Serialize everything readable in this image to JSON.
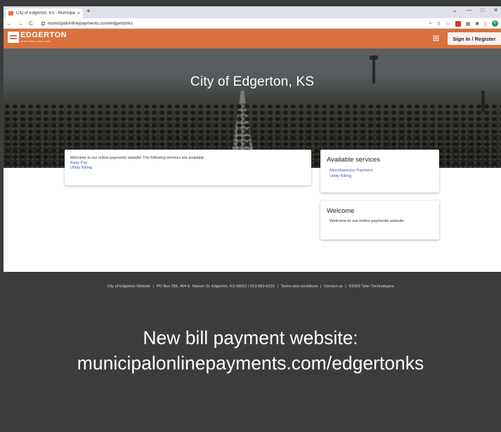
{
  "browser": {
    "tab_title": "City of Edgerton, KS - Municipal",
    "tab_close": "×",
    "new_tab": "+",
    "url": "municipalonlinepayments.com/edgertonks",
    "back": "←",
    "forward": "→",
    "reload": "C",
    "win_minimize": "—",
    "win_restore": "□",
    "win_close": "✕",
    "tab_list": "⌄",
    "profile_initial": "K"
  },
  "header": {
    "logo_name": "EDGERTON",
    "logo_tag": "small routes. local roots.",
    "signin_label": "Sign In / Register"
  },
  "hero": {
    "title": "City of Edgerton, KS"
  },
  "main_card": {
    "intro": "Welcome to our online payments website! The following services are available:",
    "links": [
      "Easy Pay",
      "Utility Billing"
    ]
  },
  "services_card": {
    "title": "Available services",
    "links": [
      "Miscellaneous Payment",
      "Utility Billing"
    ]
  },
  "welcome_card": {
    "title": "Welcome",
    "text": "Welcome to our online payments website."
  },
  "footer": {
    "items": [
      "City of Edgerton Website",
      "PO Box 255, 404 E. Nelson St. Edgerton, KS 66021 | 913-893-6231",
      "Terms and conditions",
      "Contact us",
      "©2023 Tyler Technologies"
    ],
    "separator": "|"
  },
  "announcement": {
    "line1": "New bill payment website:",
    "line2": "municipalonlinepayments.com/edgertonks"
  },
  "colors": {
    "brand": "#d9723f",
    "link": "#3f5bb5",
    "dark_panel": "#3c3c3c"
  }
}
